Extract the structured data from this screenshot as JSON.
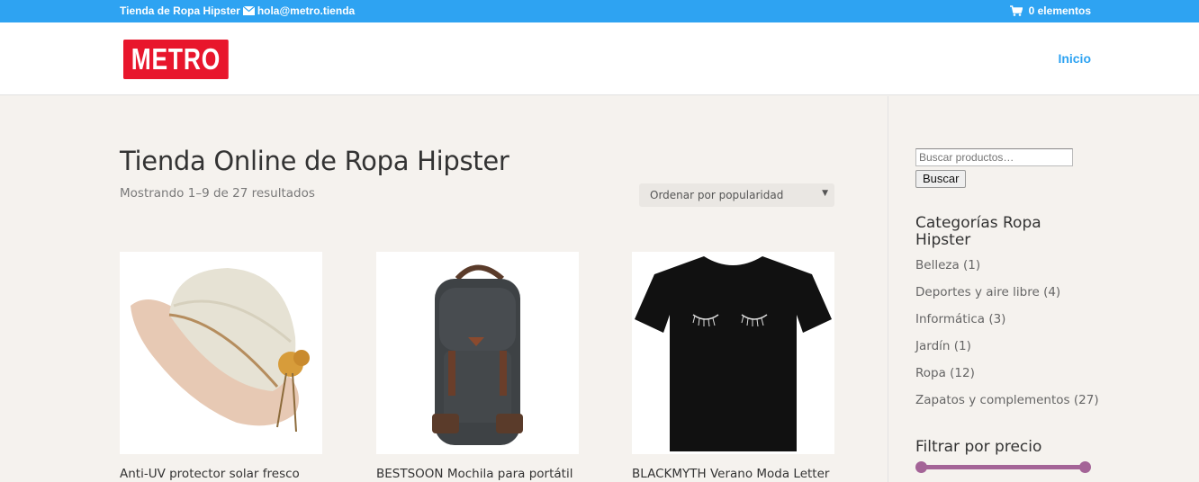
{
  "topbar": {
    "store_name": "Tienda de Ropa Hipster",
    "email": "hola@metro.tienda",
    "cart_label": "0 elementos",
    "background_color": "#2ea3f2"
  },
  "header": {
    "logo_text": "METRO",
    "logo_color": "#e8162c",
    "nav_home": "Inicio",
    "nav_color": "#2ea3f2"
  },
  "shop": {
    "title": "Tienda Online de Ropa Hipster",
    "result_count": "Mostrando 1–9 de 27 resultados",
    "orderby_selected": "Ordenar por popularidad",
    "products": [
      {
        "title": "Anti-UV protector solar fresco",
        "image": "straw-hat-image"
      },
      {
        "title": "BESTSOON Mochila para portátil",
        "image": "backpack-image"
      },
      {
        "title": "BLACKMYTH Verano Moda Letter",
        "image": "black-tshirt-image"
      }
    ]
  },
  "sidebar": {
    "search_placeholder": "Buscar productos…",
    "search_button": "Buscar",
    "categories_title": "Categorías Ropa Hipster",
    "categories": [
      {
        "label": "Belleza (1)"
      },
      {
        "label": "Deportes y aire libre (4)"
      },
      {
        "label": "Informática (3)"
      },
      {
        "label": "Jardín (1)"
      },
      {
        "label": "Ropa (12)"
      },
      {
        "label": "Zapatos y complementos (27)"
      }
    ],
    "price_filter_title": "Filtrar por precio",
    "price_slider_color": "#a46497"
  }
}
